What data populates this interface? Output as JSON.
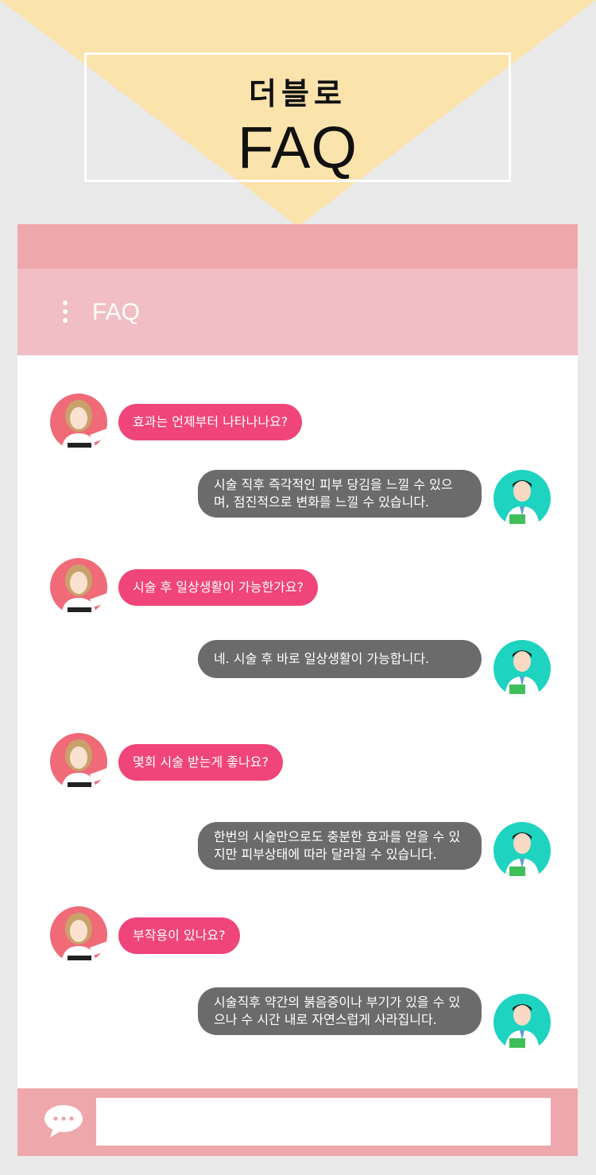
{
  "page": {
    "title_kr": "더블로",
    "title_en": "FAQ"
  },
  "chat": {
    "header_label": "FAQ",
    "input_placeholder": "",
    "messages": [
      {
        "question": "효과는 언제부터 나타나나요?",
        "answer": "시술 직후 즉각적인 피부 당김을 느낄 수 있으며, 점진적으로 변화를 느낄 수 있습니다."
      },
      {
        "question": "시술 후 일상생활이 가능한가요?",
        "answer": "네. 시술 후 바로 일상생활이 가능합니다."
      },
      {
        "question": "몇회 시술 받는게 좋나요?",
        "answer": "한번의 시술만으로도 충분한 효과를 얻을 수 있지만 피부상태에 따라 달라질 수 있습니다."
      },
      {
        "question": "부작용이 있나요?",
        "answer": "시술직후 약간의 붉음증이나 부기가 있을 수 있으나 수 시간 내로 자연스럽게 사라집니다."
      }
    ]
  },
  "colors": {
    "triangle": "#fbe3ac",
    "question_bubble": "#f0457a",
    "answer_bubble": "#6b6b6b",
    "header_pink": "#f1bfc3",
    "footer_pink": "#eea7ab",
    "doctor_avatar": "#1ed3c0",
    "patient_avatar": "#f06a78"
  }
}
